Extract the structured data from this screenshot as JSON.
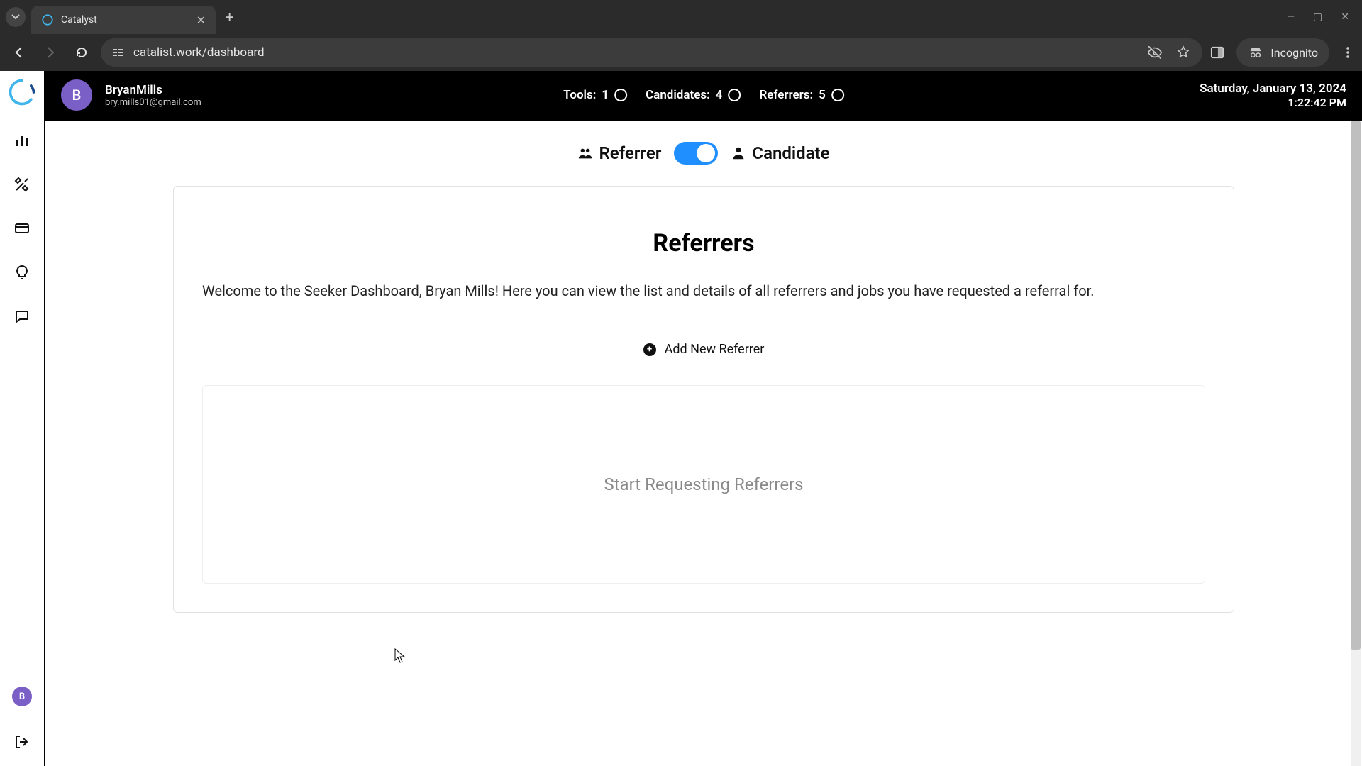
{
  "browser": {
    "tab_title": "Catalyst",
    "url": "catalist.work/dashboard",
    "incognito_label": "Incognito"
  },
  "topbar": {
    "user_initial": "B",
    "user_name": "BryanMills",
    "user_email": "bry.mills01@gmail.com",
    "stats": {
      "tools_label": "Tools:",
      "tools_value": "1",
      "candidates_label": "Candidates:",
      "candidates_value": "4",
      "referrers_label": "Referrers:",
      "referrers_value": "5"
    },
    "date": "Saturday, January 13, 2024",
    "time": "1:22:42 PM"
  },
  "mode": {
    "referrer_label": "Referrer",
    "candidate_label": "Candidate",
    "state": "candidate"
  },
  "panel": {
    "title": "Referrers",
    "welcome": "Welcome to the Seeker Dashboard, Bryan Mills! Here you can view the list and details of all referrers and jobs you have requested a referral for.",
    "add_label": "Add New Referrer",
    "empty_text": "Start Requesting Referrers"
  },
  "sidebar": {
    "avatar_initial": "B"
  }
}
